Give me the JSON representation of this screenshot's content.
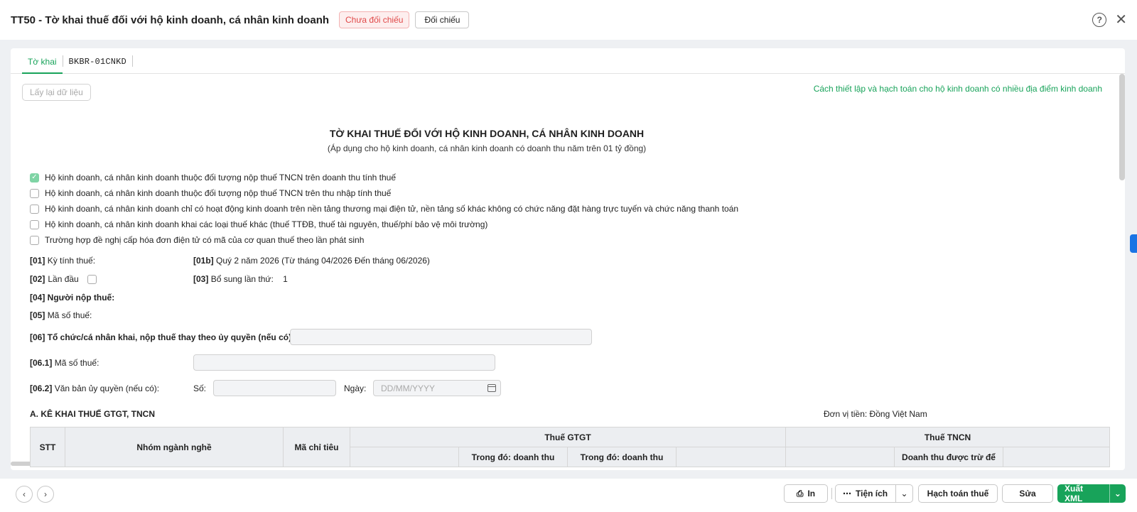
{
  "header": {
    "title": "TT50 - Tờ khai thuế đối với hộ kinh doanh, cá nhân kinh doanh",
    "status_badge": "Chưa đối chiếu",
    "compare_button": "Đối chiếu",
    "help_icon": "?",
    "close_icon": "✕"
  },
  "tabs": [
    {
      "label": "Tờ khai",
      "active": true
    },
    {
      "label": "BKBR-01CNKD",
      "active": false
    }
  ],
  "toolbar": {
    "reload_button": "Lấy lại dữ liệu",
    "help_link": "Cách thiết lập và hạch toán cho hộ kinh doanh có nhiều địa điểm kinh doanh"
  },
  "form": {
    "title": "TỜ KHAI THUẾ ĐỐI VỚI HỘ KINH DOANH, CÁ NHÂN KINH DOANH",
    "subtitle": "(Áp dụng cho hộ kinh doanh, cá nhân kinh doanh có doanh thu năm trên 01 tỷ đồng)",
    "checkboxes": [
      {
        "label": "Hộ kinh doanh, cá nhân kinh doanh thuộc đối tượng nộp thuế TNCN trên doanh thu tính thuế",
        "checked": true
      },
      {
        "label": "Hộ kinh doanh, cá nhân kinh doanh thuộc đối tượng nộp thuế TNCN trên thu nhập tính thuế",
        "checked": false
      },
      {
        "label": "Hộ kinh doanh, cá nhân kinh doanh chỉ có hoạt động kinh doanh trên nền tảng thương mại điện tử, nền tảng số khác không có chức năng đặt hàng trực tuyến và chức năng thanh toán",
        "checked": false
      },
      {
        "label": "Hộ kinh doanh, cá nhân kinh doanh khai các loại thuế khác (thuế TTĐB, thuế tài nguyên, thuế/phí bảo vệ môi trường)",
        "checked": false
      },
      {
        "label": "Trường hợp đề nghị cấp hóa đơn điện tử có mã của cơ quan thuế theo lần phát sinh",
        "checked": false
      }
    ],
    "f01_code": "[01]",
    "f01_label": "Kỳ tính thuế:",
    "f01b_code": "[01b]",
    "f01b_value": "Quý 2 năm 2026 (Từ tháng 04/2026 Đến tháng 06/2026)",
    "f02_code": "[02]",
    "f02_label": "Lần đầu",
    "f03_code": "[03]",
    "f03_label": "Bổ sung lần thứ:",
    "f03_value": "1",
    "f04_label": "[04] Người nộp thuế:",
    "f05_code": "[05]",
    "f05_label": "Mã số thuế:",
    "f06_label": "[06] Tổ chức/cá nhân khai, nộp thuế thay theo ủy quyền (nếu có):",
    "f061_code": "[06.1]",
    "f061_label": "Mã số thuế:",
    "f062_code": "[06.2]",
    "f062_label": "Văn bản ủy quyền (nếu có):",
    "so_label": "Số:",
    "ngay_label": "Ngày:",
    "date_placeholder": "DD/MM/YYYY",
    "section_a": "A. KÊ KHAI THUẾ GTGT, TNCN",
    "currency": "Đơn vị tiền: Đồng Việt Nam"
  },
  "table": {
    "stt": "STT",
    "group": "Nhóm ngành nghề",
    "code": "Mã chỉ tiêu",
    "vat": "Thuế GTGT",
    "pit": "Thuế TNCN",
    "vat_sub1": "Trong đó: doanh thu",
    "vat_sub2": "Trong đó: doanh thu",
    "pit_sub": "Doanh thu được trừ để"
  },
  "footer": {
    "prev_icon": "‹",
    "next_icon": "›",
    "print_label": "In",
    "utilities_label": "Tiện ích",
    "accounting_label": "Hạch toán thuế",
    "edit_label": "Sửa",
    "export_label": "Xuất XML"
  },
  "colors": {
    "accent": "#18a35a",
    "badge": "#e04848"
  }
}
